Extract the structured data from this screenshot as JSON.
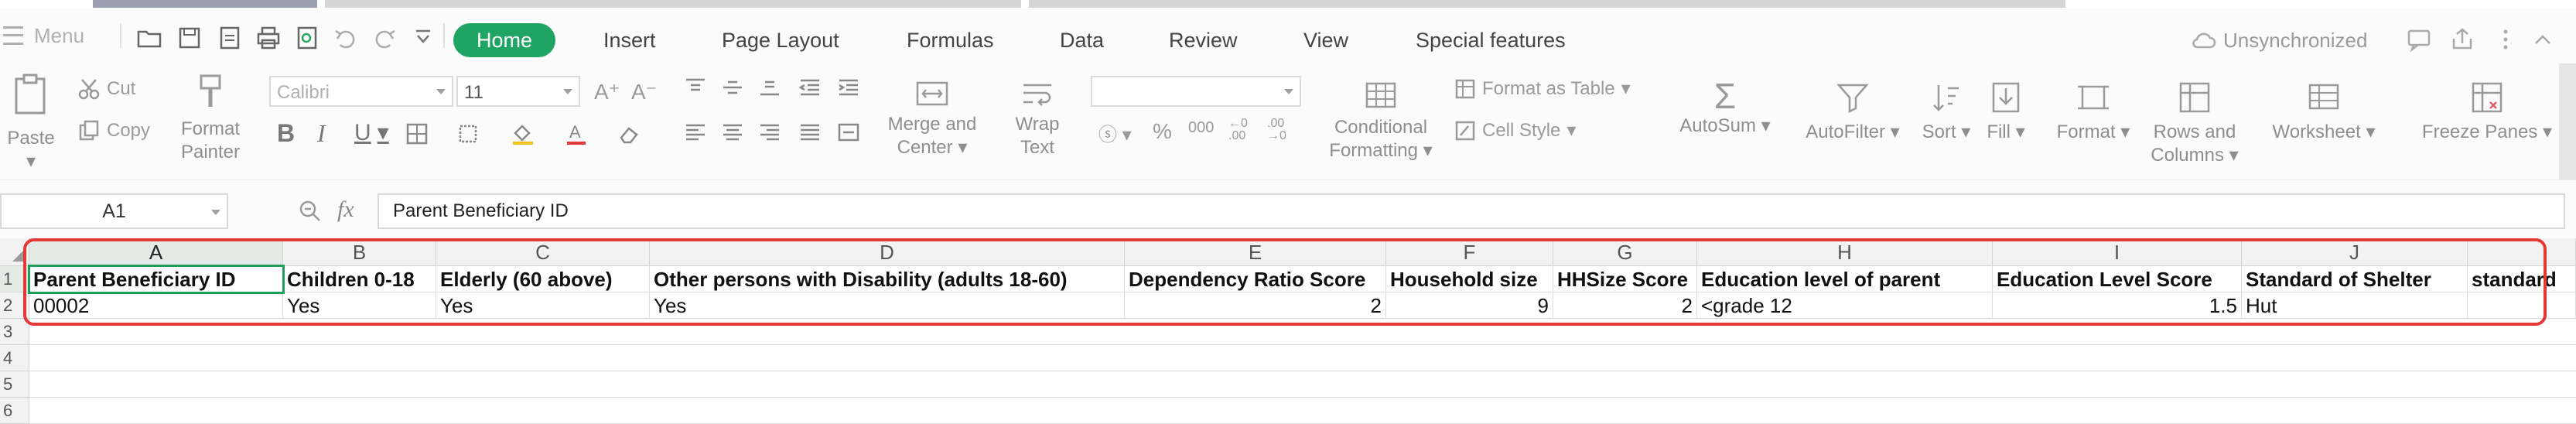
{
  "menu_label": "Menu",
  "tabs": [
    {
      "label": "Home",
      "active": true
    },
    {
      "label": "Insert"
    },
    {
      "label": "Page Layout"
    },
    {
      "label": "Formulas"
    },
    {
      "label": "Data"
    },
    {
      "label": "Review"
    },
    {
      "label": "View"
    },
    {
      "label": "Special features"
    }
  ],
  "sync_status": "Unsynchronized",
  "ribbon": {
    "paste": "Paste",
    "cut": "Cut",
    "copy": "Copy",
    "format_painter_1": "Format",
    "format_painter_2": "Painter",
    "font_name": "Calibri",
    "font_size": "11",
    "merge_1": "Merge and",
    "merge_2": "Center",
    "wrap_1": "Wrap",
    "wrap_2": "Text",
    "cond_1": "Conditional",
    "cond_2": "Formatting",
    "format_as_table": "Format as Table",
    "cell_style": "Cell Style",
    "autosum": "AutoSum",
    "autofilter": "AutoFilter",
    "sort": "Sort",
    "fill": "Fill",
    "format": "Format",
    "rows_cols_1": "Rows and",
    "rows_cols_2": "Columns",
    "worksheet": "Worksheet",
    "freeze": "Freeze Panes",
    "percent": "%",
    "thousands": "000"
  },
  "formula_bar": {
    "name_box": "A1",
    "fx": "fx",
    "content": "Parent Beneficiary ID"
  },
  "columns": [
    "A",
    "B",
    "C",
    "D",
    "E",
    "F",
    "G",
    "H",
    "I",
    "J"
  ],
  "rows": [
    "1",
    "2",
    "3",
    "4",
    "5",
    "6"
  ],
  "header_row": [
    "Parent Beneficiary ID",
    "Children 0-18",
    "Elderly (60 above)",
    "Other persons with Disability (adults 18-60)",
    "Dependency Ratio Score",
    "Household size",
    "HHSize Score",
    "Education level of parent",
    "Education Level Score",
    "Standard of Shelter",
    "standard"
  ],
  "data_row": [
    "00002",
    "Yes",
    "Yes",
    "Yes",
    "2",
    "9",
    "2",
    "<grade 12",
    "1.5",
    "Hut",
    ""
  ],
  "colors": {
    "accent_green": "#1fa463",
    "selection_green": "#1f9c5a",
    "highlight_red": "#e53935"
  }
}
